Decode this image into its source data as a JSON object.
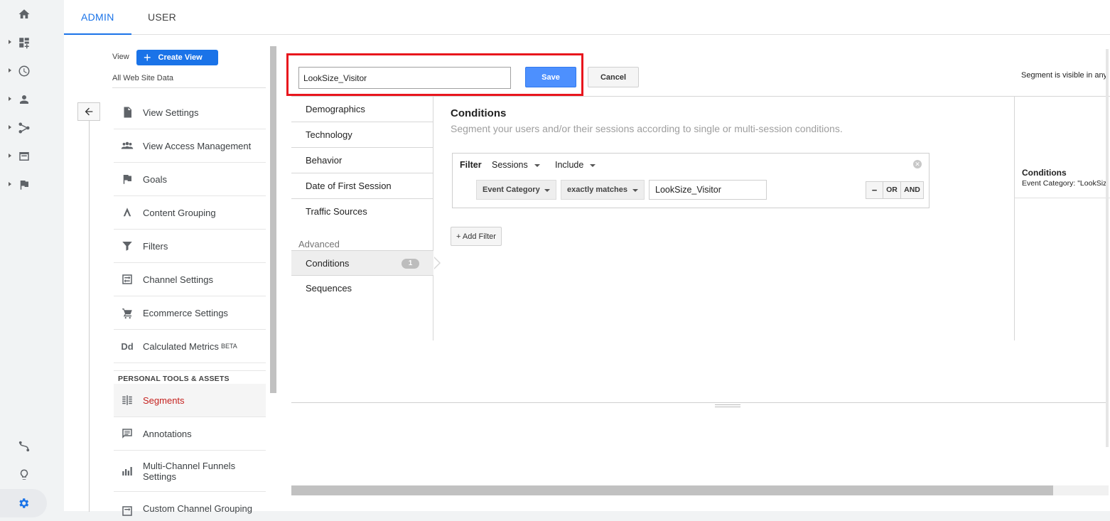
{
  "top_tabs": {
    "admin": "ADMIN",
    "user": "USER"
  },
  "view": {
    "label": "View",
    "create_label": "Create View",
    "subtitle": "All Web Site Data"
  },
  "menu": [
    {
      "label": "View Settings"
    },
    {
      "label": "View Access Management"
    },
    {
      "label": "Goals"
    },
    {
      "label": "Content Grouping"
    },
    {
      "label": "Filters"
    },
    {
      "label": "Channel Settings"
    },
    {
      "label": "Ecommerce Settings"
    },
    {
      "label": "Calculated Metrics",
      "badge": "BETA"
    }
  ],
  "personal_section": "PERSONAL TOOLS & ASSETS",
  "personal_menu": [
    {
      "label": "Segments"
    },
    {
      "label": "Annotations"
    },
    {
      "label": "Multi-Channel Funnels",
      "label2": "Settings"
    },
    {
      "label": "Custom Channel Grouping"
    }
  ],
  "segment": {
    "name_value": "LookSize_Visitor",
    "save": "Save",
    "cancel": "Cancel",
    "visibility": "Segment is visible in any"
  },
  "categories": [
    "Demographics",
    "Technology",
    "Behavior",
    "Date of First Session",
    "Traffic Sources"
  ],
  "advanced": {
    "label": "Advanced",
    "conditions": "Conditions",
    "conditions_count": "1",
    "sequences": "Sequences"
  },
  "conditions": {
    "title": "Conditions",
    "subtitle": "Segment your users and/or their sessions according to single or multi-session conditions.",
    "filter_label": "Filter",
    "scope": "Sessions",
    "mode": "Include",
    "dimension": "Event Category",
    "operator": "exactly matches",
    "value": "LookSize_Visitor",
    "minus": "−",
    "or": "OR",
    "and": "AND",
    "add_filter": "+ Add Filter"
  },
  "summary": {
    "title": "Conditions",
    "text": "Event Category: \"LookSiz"
  }
}
